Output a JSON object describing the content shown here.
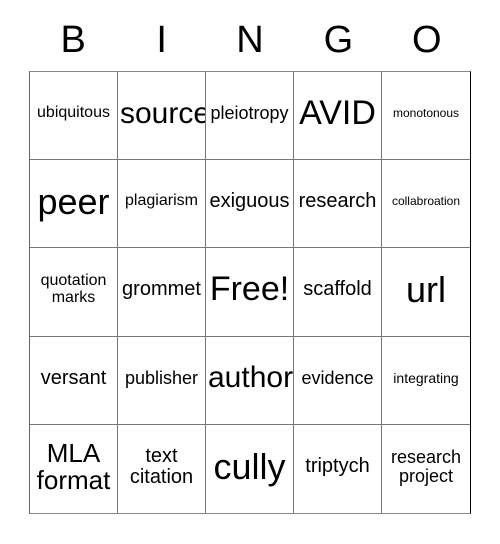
{
  "card": {
    "header_letters": [
      "B",
      "I",
      "N",
      "G",
      "O"
    ],
    "free_space_label": "Free!",
    "colors": {
      "background": "#ffffff",
      "text": "#000000",
      "grid_line": "#777777"
    },
    "rows": [
      [
        {
          "label": "ubiquitous",
          "size": "fs-s"
        },
        {
          "label": "source",
          "size": "fs-xxl"
        },
        {
          "label": "pleiotropy",
          "size": "fs-m"
        },
        {
          "label": "AVID",
          "size": "fs-3xl"
        },
        {
          "label": "monotonous",
          "size": "fs-xxs"
        }
      ],
      [
        {
          "label": "peer",
          "size": "fs-4xl"
        },
        {
          "label": "plagiarism",
          "size": "fs-s"
        },
        {
          "label": "exiguous",
          "size": "fs-ml"
        },
        {
          "label": "research",
          "size": "fs-ml"
        },
        {
          "label": "collabroation",
          "size": "fs-xxs"
        }
      ],
      [
        {
          "label": "quotation\nmarks",
          "size": "fs-s"
        },
        {
          "label": "grommet",
          "size": "fs-ml"
        },
        {
          "label": "Free!",
          "size": "fs-3xl"
        },
        {
          "label": "scaffold",
          "size": "fs-ml"
        },
        {
          "label": "url",
          "size": "fs-4xl"
        }
      ],
      [
        {
          "label": "versant",
          "size": "fs-ml"
        },
        {
          "label": "publisher",
          "size": "fs-m"
        },
        {
          "label": "author",
          "size": "fs-xxl"
        },
        {
          "label": "evidence",
          "size": "fs-m"
        },
        {
          "label": "integrating",
          "size": "fs-xs"
        }
      ],
      [
        {
          "label": "MLA\nformat",
          "size": "fs-xl"
        },
        {
          "label": "text\ncitation",
          "size": "fs-ml"
        },
        {
          "label": "cully",
          "size": "fs-4xl"
        },
        {
          "label": "triptych",
          "size": "fs-ml"
        },
        {
          "label": "research\nproject",
          "size": "fs-m"
        }
      ]
    ]
  }
}
